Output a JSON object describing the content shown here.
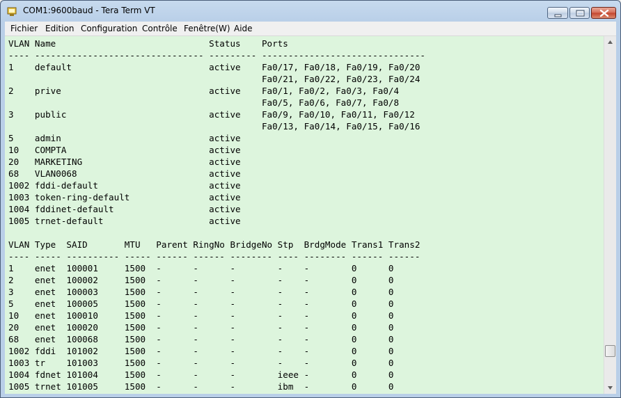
{
  "window": {
    "title": "COM1:9600baud - Tera Term VT",
    "icons": [
      "terminal-app-icon",
      "minimize-icon",
      "maximize-icon",
      "close-icon"
    ]
  },
  "menu": [
    "Fichier",
    "Edition",
    "Configuration",
    "Contrôle",
    "Fenêtre(W)",
    "Aide"
  ],
  "terminal": {
    "lines": [
      "VLAN Name                             Status    Ports",
      "---- -------------------------------- --------- -------------------------------",
      "1    default                          active    Fa0/17, Fa0/18, Fa0/19, Fa0/20",
      "                                                Fa0/21, Fa0/22, Fa0/23, Fa0/24",
      "2    prive                            active    Fa0/1, Fa0/2, Fa0/3, Fa0/4",
      "                                                Fa0/5, Fa0/6, Fa0/7, Fa0/8",
      "3    public                           active    Fa0/9, Fa0/10, Fa0/11, Fa0/12",
      "                                                Fa0/13, Fa0/14, Fa0/15, Fa0/16",
      "5    admin                            active",
      "10   COMPTA                           active",
      "20   MARKETING                        active",
      "68   VLAN0068                         active",
      "1002 fddi-default                     active",
      "1003 token-ring-default               active",
      "1004 fddinet-default                  active",
      "1005 trnet-default                    active",
      "",
      "VLAN Type  SAID       MTU   Parent RingNo BridgeNo Stp  BrdgMode Trans1 Trans2",
      "---- ----- ---------- ----- ------ ------ -------- ---- -------- ------ ------",
      "1    enet  100001     1500  -      -      -        -    -        0      0",
      "2    enet  100002     1500  -      -      -        -    -        0      0",
      "3    enet  100003     1500  -      -      -        -    -        0      0",
      "5    enet  100005     1500  -      -      -        -    -        0      0",
      "10   enet  100010     1500  -      -      -        -    -        0      0",
      "20   enet  100020     1500  -      -      -        -    -        0      0",
      "68   enet  100068     1500  -      -      -        -    -        0      0",
      "1002 fddi  101002     1500  -      -      -        -    -        0      0",
      "1003 tr    101003     1500  -      -      -        -    -        0      0",
      "1004 fdnet 101004     1500  -      -      -        ieee -        0      0",
      "1005 trnet 101005     1500  -      -      -        ibm  -        0      0"
    ]
  },
  "colors": {
    "terminal_background": "#ddf5dd",
    "terminal_text": "#000000"
  }
}
